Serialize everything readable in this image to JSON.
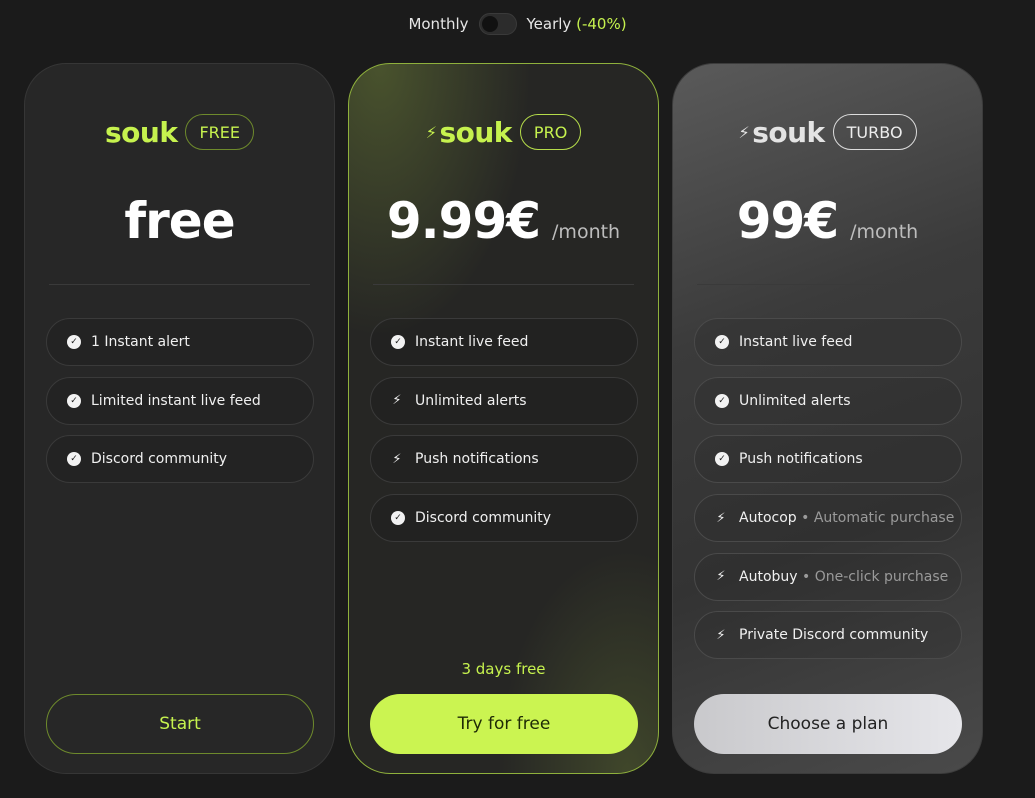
{
  "billing": {
    "monthly": "Monthly",
    "yearly": "Yearly",
    "discount": "(-40%)"
  },
  "plans": [
    {
      "brand": "souk",
      "tier": "FREE",
      "price": "free",
      "period": "",
      "features": [
        {
          "icon": "check-icon",
          "label": "1 Instant alert",
          "sub": ""
        },
        {
          "icon": "check-icon",
          "label": "Limited instant live feed",
          "sub": ""
        },
        {
          "icon": "check-icon",
          "label": "Discord community",
          "sub": ""
        }
      ],
      "trial": "",
      "cta": "Start"
    },
    {
      "brand": "souk",
      "tier": "PRO",
      "price": "9.99€",
      "period": "/month",
      "features": [
        {
          "icon": "check-icon",
          "label": "Instant live feed",
          "sub": ""
        },
        {
          "icon": "bolt-icon",
          "label": "Unlimited alerts",
          "sub": ""
        },
        {
          "icon": "bolt-icon",
          "label": "Push notifications",
          "sub": ""
        },
        {
          "icon": "check-icon",
          "label": "Discord community",
          "sub": ""
        }
      ],
      "trial": "3 days free",
      "cta": "Try for free"
    },
    {
      "brand": "souk",
      "tier": "TURBO",
      "price": "99€",
      "period": "/month",
      "features": [
        {
          "icon": "check-icon",
          "label": "Instant live feed",
          "sub": ""
        },
        {
          "icon": "check-icon",
          "label": "Unlimited alerts",
          "sub": ""
        },
        {
          "icon": "check-icon",
          "label": "Push notifications",
          "sub": ""
        },
        {
          "icon": "bolt-icon",
          "label": "Autocop",
          "sub": "• Automatic purchase"
        },
        {
          "icon": "bolt-icon",
          "label": "Autobuy",
          "sub": "• One-click purchase"
        },
        {
          "icon": "bolt-icon",
          "label": "Private Discord community",
          "sub": ""
        }
      ],
      "trial": "",
      "cta": "Choose a plan"
    }
  ],
  "colors": {
    "accent": "#c6f24e",
    "background": "#1b1b1b"
  }
}
